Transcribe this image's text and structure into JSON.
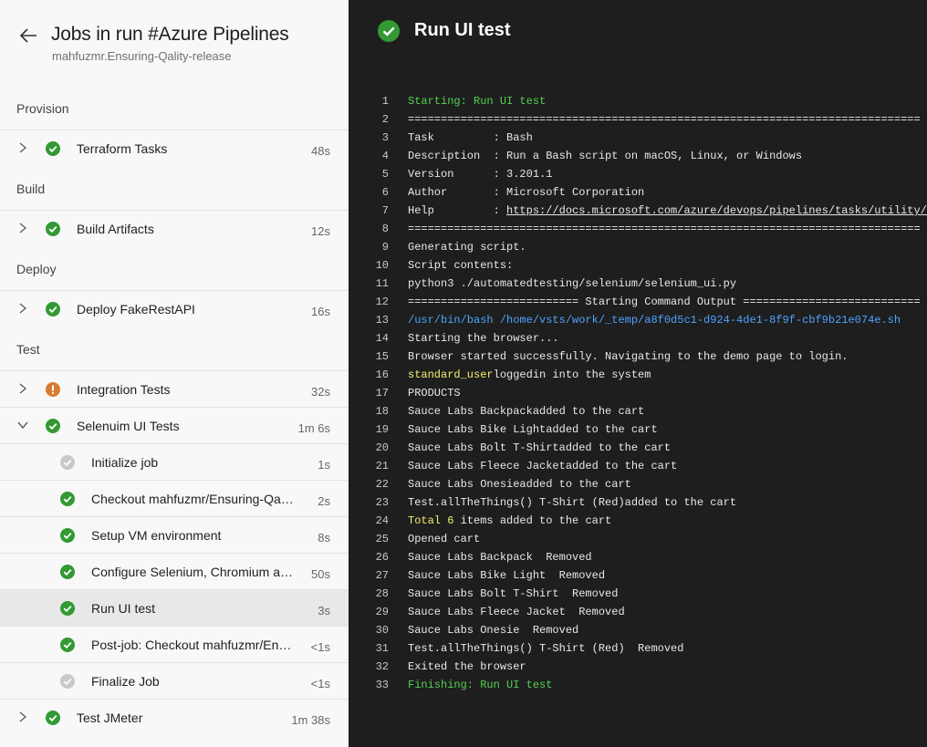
{
  "sidebar": {
    "title": "Jobs in run #Azure Pipelines",
    "subtitle": "mahfuzmr.Ensuring-Qality-release",
    "stages": {
      "provision": "Provision",
      "build": "Build",
      "deploy": "Deploy",
      "test": "Test"
    },
    "jobs": {
      "terraform": {
        "label": "Terraform Tasks",
        "duration": "48s",
        "status": "succeeded"
      },
      "build_artifacts": {
        "label": "Build Artifacts",
        "duration": "12s",
        "status": "succeeded"
      },
      "deploy_fake": {
        "label": "Deploy FakeRestAPI",
        "duration": "16s",
        "status": "succeeded"
      },
      "integration": {
        "label": "Integration Tests",
        "duration": "32s",
        "status": "warning"
      },
      "selenium": {
        "label": "Selenuim UI Tests",
        "duration": "1m 6s",
        "status": "succeeded"
      },
      "jmeter": {
        "label": "Test JMeter",
        "duration": "1m 38s",
        "status": "succeeded"
      }
    },
    "steps": [
      {
        "label": "Initialize job",
        "duration": "1s",
        "status": "skipped"
      },
      {
        "label": "Checkout mahfuzmr/Ensuring-Qality-release",
        "duration": "2s",
        "status": "succeeded"
      },
      {
        "label": "Setup VM environment",
        "duration": "8s",
        "status": "succeeded"
      },
      {
        "label": "Configure Selenium, Chromium and Chromedriver",
        "duration": "50s",
        "status": "succeeded"
      },
      {
        "label": "Run UI test",
        "duration": "3s",
        "status": "succeeded"
      },
      {
        "label": "Post-job: Checkout mahfuzmr/Ensuring-Qality-release",
        "duration": "<1s",
        "status": "succeeded"
      },
      {
        "label": "Finalize Job",
        "duration": "<1s",
        "status": "skipped"
      }
    ]
  },
  "log_panel": {
    "title": "Run UI test",
    "lines": [
      {
        "num": "1",
        "segments": [
          {
            "text": "Starting: Run UI test",
            "style": "green"
          }
        ]
      },
      {
        "num": "2",
        "segments": [
          {
            "text": "==============================================================================",
            "style": ""
          }
        ]
      },
      {
        "num": "3",
        "segments": [
          {
            "text": "Task         : Bash",
            "style": ""
          }
        ]
      },
      {
        "num": "4",
        "segments": [
          {
            "text": "Description  : Run a Bash script on macOS, Linux, or Windows",
            "style": ""
          }
        ]
      },
      {
        "num": "5",
        "segments": [
          {
            "text": "Version      : 3.201.1",
            "style": ""
          }
        ]
      },
      {
        "num": "6",
        "segments": [
          {
            "text": "Author       : Microsoft Corporation",
            "style": ""
          }
        ]
      },
      {
        "num": "7",
        "segments": [
          {
            "text": "Help         : ",
            "style": ""
          },
          {
            "text": "https://docs.microsoft.com/azure/devops/pipelines/tasks/utility/bash",
            "style": "link"
          }
        ]
      },
      {
        "num": "8",
        "segments": [
          {
            "text": "==============================================================================",
            "style": ""
          }
        ]
      },
      {
        "num": "9",
        "segments": [
          {
            "text": "Generating script.",
            "style": ""
          }
        ]
      },
      {
        "num": "10",
        "segments": [
          {
            "text": "Script contents:",
            "style": ""
          }
        ]
      },
      {
        "num": "11",
        "segments": [
          {
            "text": "python3 ./automatedtesting/selenium/selenium_ui.py",
            "style": ""
          }
        ]
      },
      {
        "num": "12",
        "segments": [
          {
            "text": "========================== Starting Command Output ===========================",
            "style": ""
          }
        ]
      },
      {
        "num": "13",
        "segments": [
          {
            "text": "/usr/bin/bash /home/vsts/work/_temp/a8f0d5c1-d924-4de1-8f9f-cbf9b21e074e.sh",
            "style": "blue"
          }
        ]
      },
      {
        "num": "14",
        "segments": [
          {
            "text": "Starting the browser...",
            "style": ""
          }
        ]
      },
      {
        "num": "15",
        "segments": [
          {
            "text": "Browser started successfully. Navigating to the demo page to login.",
            "style": ""
          }
        ]
      },
      {
        "num": "16",
        "segments": [
          {
            "text": "standard_user",
            "style": "yellow"
          },
          {
            "text": "loggedin into the system",
            "style": ""
          }
        ]
      },
      {
        "num": "17",
        "segments": [
          {
            "text": "PRODUCTS",
            "style": ""
          }
        ]
      },
      {
        "num": "18",
        "segments": [
          {
            "text": "Sauce Labs Backpackadded to the cart",
            "style": ""
          }
        ]
      },
      {
        "num": "19",
        "segments": [
          {
            "text": "Sauce Labs Bike Lightadded to the cart",
            "style": ""
          }
        ]
      },
      {
        "num": "20",
        "segments": [
          {
            "text": "Sauce Labs Bolt T-Shirtadded to the cart",
            "style": ""
          }
        ]
      },
      {
        "num": "21",
        "segments": [
          {
            "text": "Sauce Labs Fleece Jacketadded to the cart",
            "style": ""
          }
        ]
      },
      {
        "num": "22",
        "segments": [
          {
            "text": "Sauce Labs Onesieadded to the cart",
            "style": ""
          }
        ]
      },
      {
        "num": "23",
        "segments": [
          {
            "text": "Test.allTheThings() T-Shirt (Red)added to the cart",
            "style": ""
          }
        ]
      },
      {
        "num": "24",
        "segments": [
          {
            "text": "Total 6",
            "style": "yellow"
          },
          {
            "text": " items added to the cart",
            "style": ""
          }
        ]
      },
      {
        "num": "25",
        "segments": [
          {
            "text": "Opened cart",
            "style": ""
          }
        ]
      },
      {
        "num": "26",
        "segments": [
          {
            "text": "Sauce Labs Backpack  Removed",
            "style": ""
          }
        ]
      },
      {
        "num": "27",
        "segments": [
          {
            "text": "Sauce Labs Bike Light  Removed",
            "style": ""
          }
        ]
      },
      {
        "num": "28",
        "segments": [
          {
            "text": "Sauce Labs Bolt T-Shirt  Removed",
            "style": ""
          }
        ]
      },
      {
        "num": "29",
        "segments": [
          {
            "text": "Sauce Labs Fleece Jacket  Removed",
            "style": ""
          }
        ]
      },
      {
        "num": "30",
        "segments": [
          {
            "text": "Sauce Labs Onesie  Removed",
            "style": ""
          }
        ]
      },
      {
        "num": "31",
        "segments": [
          {
            "text": "Test.allTheThings() T-Shirt (Red)  Removed",
            "style": ""
          }
        ]
      },
      {
        "num": "32",
        "segments": [
          {
            "text": "Exited the browser",
            "style": ""
          }
        ]
      },
      {
        "num": "33",
        "segments": [
          {
            "text": "Finishing: Run UI test",
            "style": "green"
          }
        ]
      }
    ]
  },
  "colors": {
    "success": "#339933",
    "warning": "#da7b31",
    "skipped": "#c8c8c8",
    "log_green": "#55d053",
    "log_blue": "#4fa3ff",
    "log_yellow": "#f5f06e"
  },
  "icons": {
    "back": "arrow-left-icon",
    "expand": "chevron-right-icon",
    "collapse": "chevron-down-icon",
    "succeeded": "check-circle-icon",
    "warning": "exclamation-circle-icon",
    "skipped": "check-circle-gray-icon"
  }
}
